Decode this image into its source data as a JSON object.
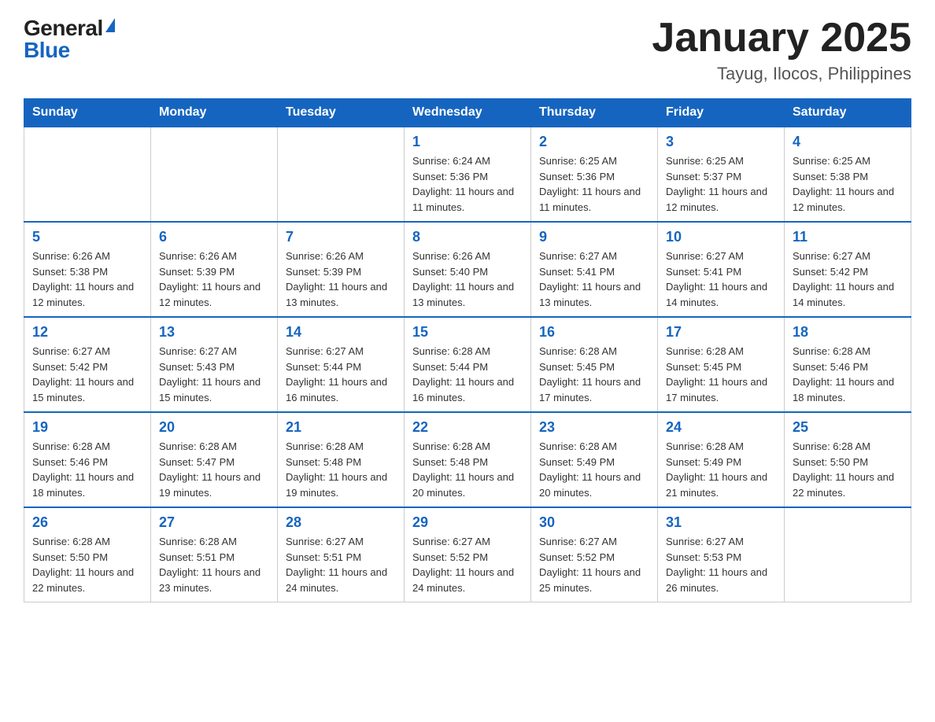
{
  "header": {
    "logo_general": "General",
    "logo_blue": "Blue",
    "title": "January 2025",
    "subtitle": "Tayug, Ilocos, Philippines"
  },
  "days_of_week": [
    "Sunday",
    "Monday",
    "Tuesday",
    "Wednesday",
    "Thursday",
    "Friday",
    "Saturday"
  ],
  "weeks": [
    {
      "days": [
        {
          "num": "",
          "info": ""
        },
        {
          "num": "",
          "info": ""
        },
        {
          "num": "",
          "info": ""
        },
        {
          "num": "1",
          "info": "Sunrise: 6:24 AM\nSunset: 5:36 PM\nDaylight: 11 hours\nand 11 minutes."
        },
        {
          "num": "2",
          "info": "Sunrise: 6:25 AM\nSunset: 5:36 PM\nDaylight: 11 hours\nand 11 minutes."
        },
        {
          "num": "3",
          "info": "Sunrise: 6:25 AM\nSunset: 5:37 PM\nDaylight: 11 hours\nand 12 minutes."
        },
        {
          "num": "4",
          "info": "Sunrise: 6:25 AM\nSunset: 5:38 PM\nDaylight: 11 hours\nand 12 minutes."
        }
      ]
    },
    {
      "days": [
        {
          "num": "5",
          "info": "Sunrise: 6:26 AM\nSunset: 5:38 PM\nDaylight: 11 hours\nand 12 minutes."
        },
        {
          "num": "6",
          "info": "Sunrise: 6:26 AM\nSunset: 5:39 PM\nDaylight: 11 hours\nand 12 minutes."
        },
        {
          "num": "7",
          "info": "Sunrise: 6:26 AM\nSunset: 5:39 PM\nDaylight: 11 hours\nand 13 minutes."
        },
        {
          "num": "8",
          "info": "Sunrise: 6:26 AM\nSunset: 5:40 PM\nDaylight: 11 hours\nand 13 minutes."
        },
        {
          "num": "9",
          "info": "Sunrise: 6:27 AM\nSunset: 5:41 PM\nDaylight: 11 hours\nand 13 minutes."
        },
        {
          "num": "10",
          "info": "Sunrise: 6:27 AM\nSunset: 5:41 PM\nDaylight: 11 hours\nand 14 minutes."
        },
        {
          "num": "11",
          "info": "Sunrise: 6:27 AM\nSunset: 5:42 PM\nDaylight: 11 hours\nand 14 minutes."
        }
      ]
    },
    {
      "days": [
        {
          "num": "12",
          "info": "Sunrise: 6:27 AM\nSunset: 5:42 PM\nDaylight: 11 hours\nand 15 minutes."
        },
        {
          "num": "13",
          "info": "Sunrise: 6:27 AM\nSunset: 5:43 PM\nDaylight: 11 hours\nand 15 minutes."
        },
        {
          "num": "14",
          "info": "Sunrise: 6:27 AM\nSunset: 5:44 PM\nDaylight: 11 hours\nand 16 minutes."
        },
        {
          "num": "15",
          "info": "Sunrise: 6:28 AM\nSunset: 5:44 PM\nDaylight: 11 hours\nand 16 minutes."
        },
        {
          "num": "16",
          "info": "Sunrise: 6:28 AM\nSunset: 5:45 PM\nDaylight: 11 hours\nand 17 minutes."
        },
        {
          "num": "17",
          "info": "Sunrise: 6:28 AM\nSunset: 5:45 PM\nDaylight: 11 hours\nand 17 minutes."
        },
        {
          "num": "18",
          "info": "Sunrise: 6:28 AM\nSunset: 5:46 PM\nDaylight: 11 hours\nand 18 minutes."
        }
      ]
    },
    {
      "days": [
        {
          "num": "19",
          "info": "Sunrise: 6:28 AM\nSunset: 5:46 PM\nDaylight: 11 hours\nand 18 minutes."
        },
        {
          "num": "20",
          "info": "Sunrise: 6:28 AM\nSunset: 5:47 PM\nDaylight: 11 hours\nand 19 minutes."
        },
        {
          "num": "21",
          "info": "Sunrise: 6:28 AM\nSunset: 5:48 PM\nDaylight: 11 hours\nand 19 minutes."
        },
        {
          "num": "22",
          "info": "Sunrise: 6:28 AM\nSunset: 5:48 PM\nDaylight: 11 hours\nand 20 minutes."
        },
        {
          "num": "23",
          "info": "Sunrise: 6:28 AM\nSunset: 5:49 PM\nDaylight: 11 hours\nand 20 minutes."
        },
        {
          "num": "24",
          "info": "Sunrise: 6:28 AM\nSunset: 5:49 PM\nDaylight: 11 hours\nand 21 minutes."
        },
        {
          "num": "25",
          "info": "Sunrise: 6:28 AM\nSunset: 5:50 PM\nDaylight: 11 hours\nand 22 minutes."
        }
      ]
    },
    {
      "days": [
        {
          "num": "26",
          "info": "Sunrise: 6:28 AM\nSunset: 5:50 PM\nDaylight: 11 hours\nand 22 minutes."
        },
        {
          "num": "27",
          "info": "Sunrise: 6:28 AM\nSunset: 5:51 PM\nDaylight: 11 hours\nand 23 minutes."
        },
        {
          "num": "28",
          "info": "Sunrise: 6:27 AM\nSunset: 5:51 PM\nDaylight: 11 hours\nand 24 minutes."
        },
        {
          "num": "29",
          "info": "Sunrise: 6:27 AM\nSunset: 5:52 PM\nDaylight: 11 hours\nand 24 minutes."
        },
        {
          "num": "30",
          "info": "Sunrise: 6:27 AM\nSunset: 5:52 PM\nDaylight: 11 hours\nand 25 minutes."
        },
        {
          "num": "31",
          "info": "Sunrise: 6:27 AM\nSunset: 5:53 PM\nDaylight: 11 hours\nand 26 minutes."
        },
        {
          "num": "",
          "info": ""
        }
      ]
    }
  ]
}
